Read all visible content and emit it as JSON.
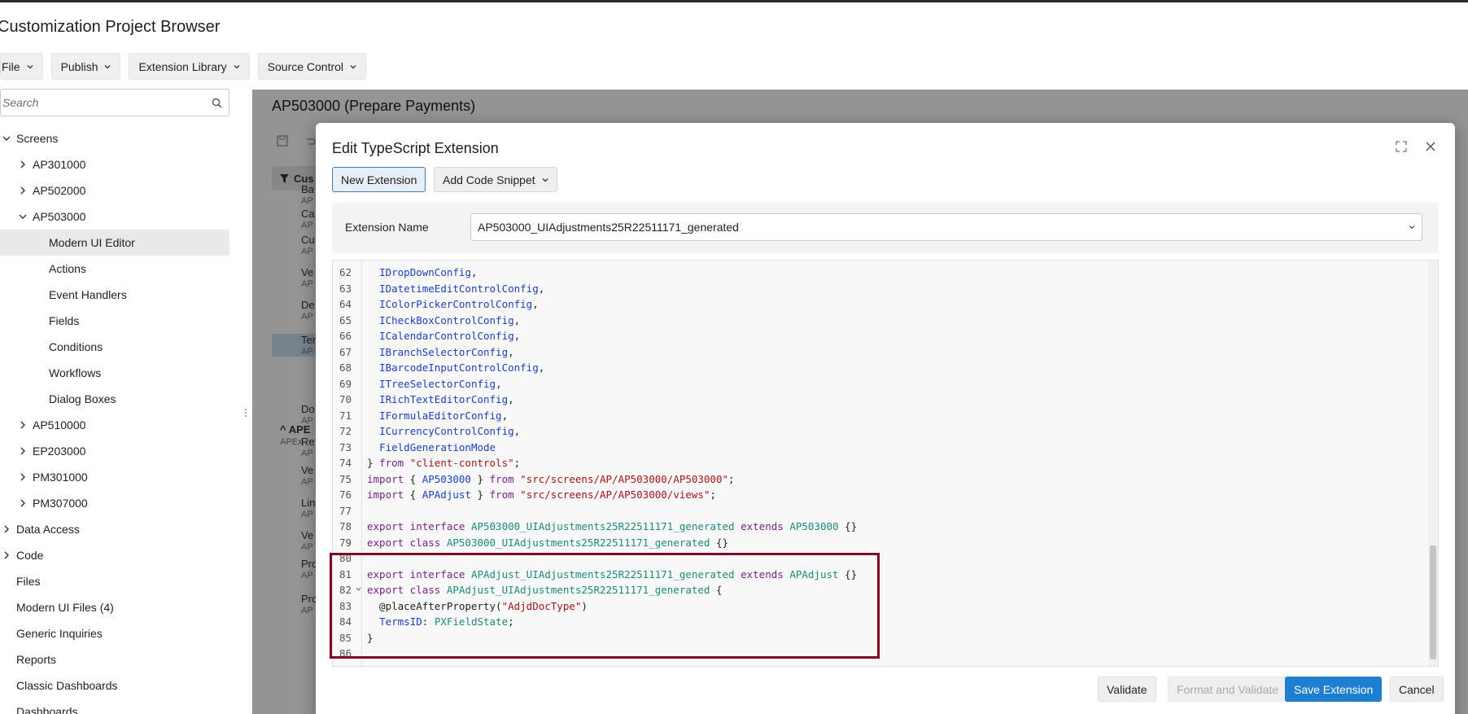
{
  "app": {
    "title": "Customization Project Browser"
  },
  "menu": [
    {
      "label": "File"
    },
    {
      "label": "Publish"
    },
    {
      "label": "Extension Library"
    },
    {
      "label": "Source Control"
    }
  ],
  "search": {
    "placeholder": "Search"
  },
  "tree": [
    {
      "label": "Screens",
      "level": 0,
      "toggle": "expanded"
    },
    {
      "label": "AP301000",
      "level": 1,
      "toggle": "collapsed"
    },
    {
      "label": "AP502000",
      "level": 1,
      "toggle": "collapsed"
    },
    {
      "label": "AP503000",
      "level": 1,
      "toggle": "expanded"
    },
    {
      "label": "Modern UI Editor",
      "level": 2,
      "toggle": "none",
      "selected": true
    },
    {
      "label": "Actions",
      "level": 2,
      "toggle": "none"
    },
    {
      "label": "Event Handlers",
      "level": 2,
      "toggle": "none"
    },
    {
      "label": "Fields",
      "level": 2,
      "toggle": "none"
    },
    {
      "label": "Conditions",
      "level": 2,
      "toggle": "none"
    },
    {
      "label": "Workflows",
      "level": 2,
      "toggle": "none"
    },
    {
      "label": "Dialog Boxes",
      "level": 2,
      "toggle": "none"
    },
    {
      "label": "AP510000",
      "level": 1,
      "toggle": "collapsed"
    },
    {
      "label": "EP203000",
      "level": 1,
      "toggle": "collapsed"
    },
    {
      "label": "PM301000",
      "level": 1,
      "toggle": "collapsed"
    },
    {
      "label": "PM307000",
      "level": 1,
      "toggle": "collapsed"
    },
    {
      "label": "Data Access",
      "level": 0,
      "toggle": "collapsed"
    },
    {
      "label": "Code",
      "level": 0,
      "toggle": "collapsed"
    },
    {
      "label": "Files",
      "level": 0,
      "toggle": "none"
    },
    {
      "label": "Modern UI Files (4)",
      "level": 0,
      "toggle": "none"
    },
    {
      "label": "Generic Inquiries",
      "level": 0,
      "toggle": "none"
    },
    {
      "label": "Reports",
      "level": 0,
      "toggle": "none"
    },
    {
      "label": "Classic Dashboards",
      "level": 0,
      "toggle": "none"
    },
    {
      "label": "Dashboards",
      "level": 0,
      "toggle": "none"
    }
  ],
  "background": {
    "screen_title": "AP503000 (Prepare Payments)",
    "chip_label": "Cus",
    "group_label": "APE",
    "group_sub": "APEx",
    "rows": [
      {
        "label": "Ba",
        "sub": "AP"
      },
      {
        "label": "Ca",
        "sub": "AP"
      },
      {
        "label": "Cu",
        "sub": "AP"
      },
      {
        "label": "Ve",
        "sub": "AP"
      },
      {
        "label": "De",
        "sub": "AP"
      },
      {
        "label": "Ter",
        "sub": "AP"
      },
      {
        "label": "Do",
        "sub": "AP"
      },
      {
        "label": "Re",
        "sub": "AP"
      },
      {
        "label": "Ve",
        "sub": "AP"
      },
      {
        "label": "Lin",
        "sub": "AP"
      },
      {
        "label": "Ve",
        "sub": "AP"
      },
      {
        "label": "Pro",
        "sub": "AP"
      },
      {
        "label": "Pro",
        "sub": "AP"
      }
    ]
  },
  "dialog": {
    "title": "Edit TypeScript Extension",
    "new_extension": "New Extension",
    "add_code_snippet": "Add Code Snippet",
    "extension_name_label": "Extension Name",
    "extension_name_value": "AP503000_UIAdjustments25R22511171_generated",
    "buttons": {
      "validate": "Validate",
      "format_validate": "Format and Validate",
      "save": "Save Extension",
      "cancel": "Cancel"
    }
  },
  "code": [
    {
      "n": "62",
      "tokens": [
        [
          "pl",
          "  "
        ],
        [
          "id",
          "IDropDownConfig"
        ],
        [
          "pl",
          ","
        ]
      ]
    },
    {
      "n": "63",
      "tokens": [
        [
          "pl",
          "  "
        ],
        [
          "id",
          "IDatetimeEditControlConfig"
        ],
        [
          "pl",
          ","
        ]
      ]
    },
    {
      "n": "64",
      "tokens": [
        [
          "pl",
          "  "
        ],
        [
          "id",
          "IColorPickerControlConfig"
        ],
        [
          "pl",
          ","
        ]
      ]
    },
    {
      "n": "65",
      "tokens": [
        [
          "pl",
          "  "
        ],
        [
          "id",
          "ICheckBoxControlConfig"
        ],
        [
          "pl",
          ","
        ]
      ]
    },
    {
      "n": "66",
      "tokens": [
        [
          "pl",
          "  "
        ],
        [
          "id",
          "ICalendarControlConfig"
        ],
        [
          "pl",
          ","
        ]
      ]
    },
    {
      "n": "67",
      "tokens": [
        [
          "pl",
          "  "
        ],
        [
          "id",
          "IBranchSelectorConfig"
        ],
        [
          "pl",
          ","
        ]
      ]
    },
    {
      "n": "68",
      "tokens": [
        [
          "pl",
          "  "
        ],
        [
          "id",
          "IBarcodeInputControlConfig"
        ],
        [
          "pl",
          ","
        ]
      ]
    },
    {
      "n": "69",
      "tokens": [
        [
          "pl",
          "  "
        ],
        [
          "id",
          "ITreeSelectorConfig"
        ],
        [
          "pl",
          ","
        ]
      ]
    },
    {
      "n": "70",
      "tokens": [
        [
          "pl",
          "  "
        ],
        [
          "id",
          "IRichTextEditorConfig"
        ],
        [
          "pl",
          ","
        ]
      ]
    },
    {
      "n": "71",
      "tokens": [
        [
          "pl",
          "  "
        ],
        [
          "id",
          "IFormulaEditorConfig"
        ],
        [
          "pl",
          ","
        ]
      ]
    },
    {
      "n": "72",
      "tokens": [
        [
          "pl",
          "  "
        ],
        [
          "id",
          "ICurrencyControlConfig"
        ],
        [
          "pl",
          ","
        ]
      ]
    },
    {
      "n": "73",
      "tokens": [
        [
          "pl",
          "  "
        ],
        [
          "id",
          "FieldGenerationMode"
        ]
      ]
    },
    {
      "n": "74",
      "tokens": [
        [
          "pl",
          "} "
        ],
        [
          "kw",
          "from"
        ],
        [
          "pl",
          " "
        ],
        [
          "st",
          "\"client-controls\""
        ],
        [
          "pl",
          ";"
        ]
      ]
    },
    {
      "n": "75",
      "tokens": [
        [
          "kw",
          "import"
        ],
        [
          "pl",
          " { "
        ],
        [
          "id",
          "AP503000"
        ],
        [
          "pl",
          " } "
        ],
        [
          "kw",
          "from"
        ],
        [
          "pl",
          " "
        ],
        [
          "st",
          "\"src/screens/AP/AP503000/AP503000\""
        ],
        [
          "pl",
          ";"
        ]
      ]
    },
    {
      "n": "76",
      "tokens": [
        [
          "kw",
          "import"
        ],
        [
          "pl",
          " { "
        ],
        [
          "id",
          "APAdjust"
        ],
        [
          "pl",
          " } "
        ],
        [
          "kw",
          "from"
        ],
        [
          "pl",
          " "
        ],
        [
          "st",
          "\"src/screens/AP/AP503000/views\""
        ],
        [
          "pl",
          ";"
        ]
      ]
    },
    {
      "n": "77",
      "tokens": []
    },
    {
      "n": "78",
      "tokens": [
        [
          "kw",
          "export interface"
        ],
        [
          "pl",
          " "
        ],
        [
          "ty",
          "AP503000_UIAdjustments25R22511171_generated"
        ],
        [
          "pl",
          " "
        ],
        [
          "kw",
          "extends"
        ],
        [
          "pl",
          " "
        ],
        [
          "ty",
          "AP503000"
        ],
        [
          "pl",
          " {}"
        ]
      ]
    },
    {
      "n": "79",
      "tokens": [
        [
          "kw",
          "export class"
        ],
        [
          "pl",
          " "
        ],
        [
          "ty",
          "AP503000_UIAdjustments25R22511171_generated"
        ],
        [
          "pl",
          " {}"
        ]
      ]
    },
    {
      "n": "80",
      "tokens": []
    },
    {
      "n": "81",
      "tokens": [
        [
          "kw",
          "export interface"
        ],
        [
          "pl",
          " "
        ],
        [
          "ty",
          "APAdjust_UIAdjustments25R22511171_generated"
        ],
        [
          "pl",
          " "
        ],
        [
          "kw",
          "extends"
        ],
        [
          "pl",
          " "
        ],
        [
          "ty",
          "APAdjust"
        ],
        [
          "pl",
          " {}"
        ]
      ]
    },
    {
      "n": "82",
      "fold": true,
      "tokens": [
        [
          "kw",
          "export class"
        ],
        [
          "pl",
          " "
        ],
        [
          "ty",
          "APAdjust_UIAdjustments25R22511171_generated"
        ],
        [
          "pl",
          " {"
        ]
      ]
    },
    {
      "n": "83",
      "tokens": [
        [
          "pl",
          "  @placeAfterProperty("
        ],
        [
          "st",
          "\"AdjdDocType\""
        ],
        [
          "pl",
          ")"
        ]
      ]
    },
    {
      "n": "84",
      "tokens": [
        [
          "pl",
          "  "
        ],
        [
          "id",
          "TermsID"
        ],
        [
          "pl",
          ": "
        ],
        [
          "ty",
          "PXFieldState"
        ],
        [
          "pl",
          ";"
        ]
      ]
    },
    {
      "n": "85",
      "tokens": [
        [
          "pl",
          "}"
        ]
      ]
    },
    {
      "n": "86",
      "tokens": []
    }
  ],
  "colors": {
    "accent": "#1e7fd0",
    "highlight_box": "#7e0b21",
    "selected_row": "#e9e9e9"
  }
}
